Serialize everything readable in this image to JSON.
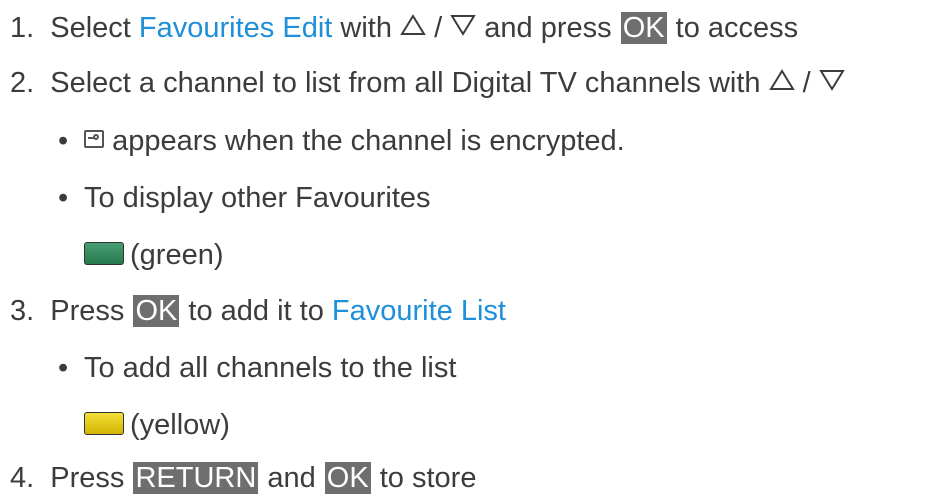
{
  "steps": [
    {
      "num": "1.",
      "t1": "Select ",
      "link": "Favourites Edit",
      "t2": " with ",
      "sep": " / ",
      "t3": " and press ",
      "key": "OK",
      "t4": " to access"
    },
    {
      "num": "2.",
      "t1": "Select a channel to list from all Digital TV channels with ",
      "sep": " / "
    },
    {
      "num": "3.",
      "t1": "Press ",
      "key": "OK",
      "t2": " to add it to ",
      "link": "Favourite List"
    },
    {
      "num": "4.",
      "t1": "Press ",
      "key1": "RETURN",
      "t2": " and ",
      "key2": "OK",
      "t3": " to store"
    }
  ],
  "notes": {
    "encrypted": "appears when the channel is encrypted.",
    "other_favourites": "To display other Favourites",
    "green_label": "(green)",
    "add_all": "To add all channels to the list",
    "yellow_label": "(yellow)"
  },
  "bullet_char": "•",
  "icons": {
    "up": "up-triangle-icon",
    "down": "down-triangle-icon",
    "encrypted": "lock-icon",
    "green_button": "green-button-icon",
    "yellow_button": "yellow-button-icon"
  },
  "colors": {
    "text": "#3c3c3c",
    "link": "#1e8fd8",
    "key_bg": "#6e6e6e",
    "green": "#2e8b57",
    "yellow": "#e6c800"
  }
}
